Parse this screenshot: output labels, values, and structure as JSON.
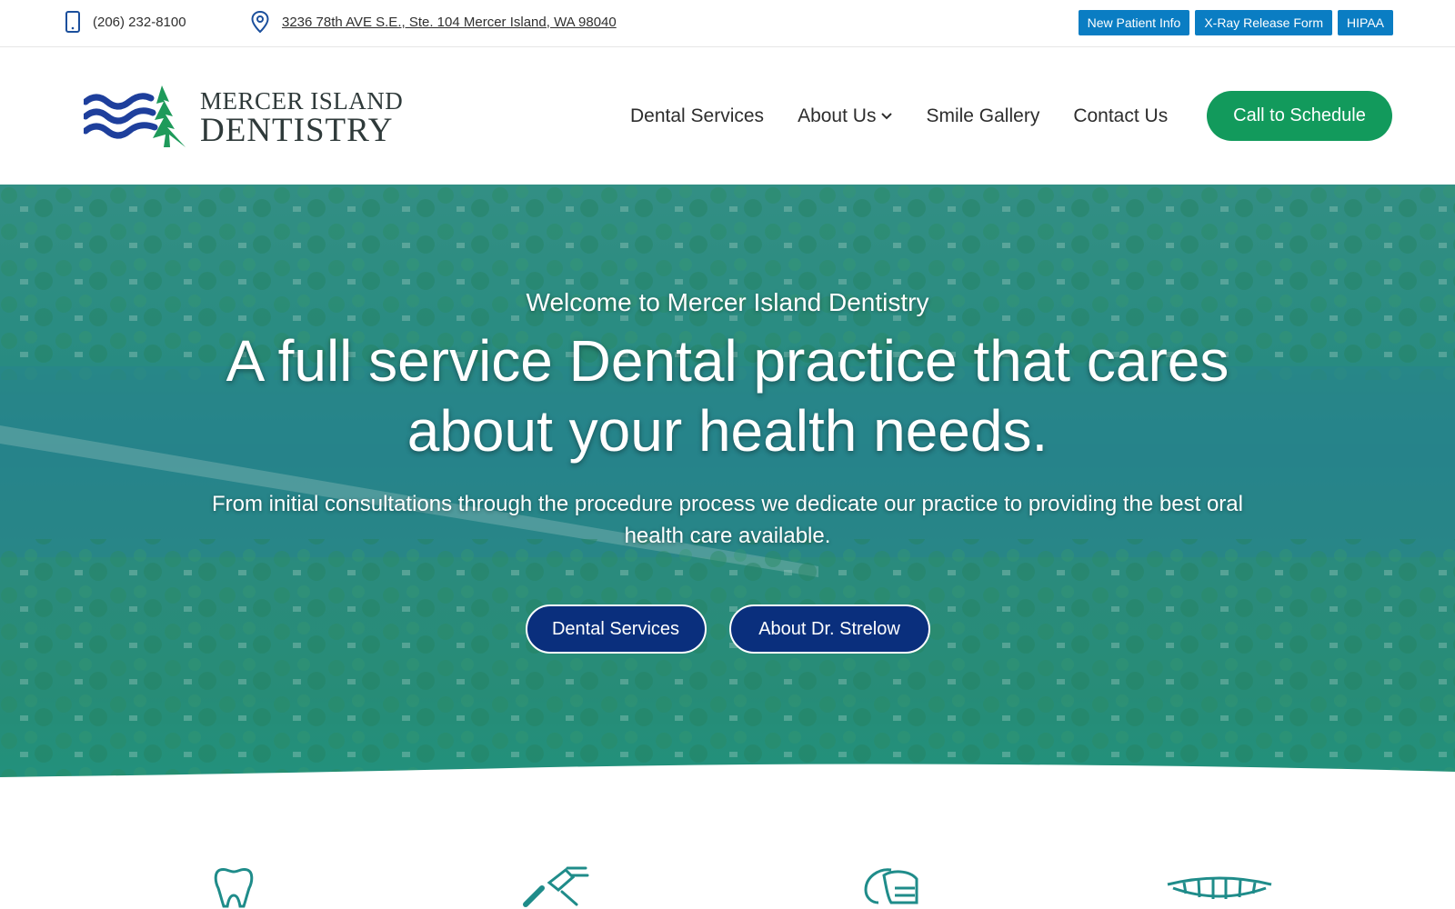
{
  "topbar": {
    "phone": "(206) 232-8100",
    "address": "3236 78th AVE S.E., Ste. 104 Mercer Island, WA 98040",
    "quick_links": [
      {
        "label": "New Patient Info"
      },
      {
        "label": "X-Ray Release Form"
      },
      {
        "label": "HIPAA"
      }
    ],
    "icons": {
      "phone": "mobile-phone-icon",
      "address": "map-pin-icon"
    }
  },
  "header": {
    "logo": {
      "line1": "MERCER ISLAND",
      "line2": "DENTISTRY"
    },
    "nav": [
      {
        "label": "Dental Services"
      },
      {
        "label": "About Us"
      },
      {
        "label": "Smile Gallery"
      },
      {
        "label": "Contact Us"
      }
    ],
    "cta": "Call to Schedule"
  },
  "hero": {
    "eyebrow": "Welcome to Mercer Island Dentistry",
    "headline_line1": "A full service Dental practice that cares",
    "headline_line2": "about your health needs.",
    "subtext": "From initial consultations through the procedure process we dedicate our practice to providing the best oral health care available.",
    "buttons": [
      {
        "label": "Dental Services"
      },
      {
        "label": "About Dr. Strelow"
      }
    ]
  },
  "features": {
    "icons": [
      "tooth-icon",
      "dental-tools-icon",
      "dentist-mask-icon",
      "dental-bridge-icon"
    ]
  },
  "colors": {
    "quick_link_bg": "#0a7dc3",
    "cta_green": "#129a5c",
    "hero_button_navy": "#0a2f7d",
    "logo_blue": "#1e3f9c",
    "logo_green": "#1e9a5a",
    "icon_teal": "#1f8c8a"
  }
}
